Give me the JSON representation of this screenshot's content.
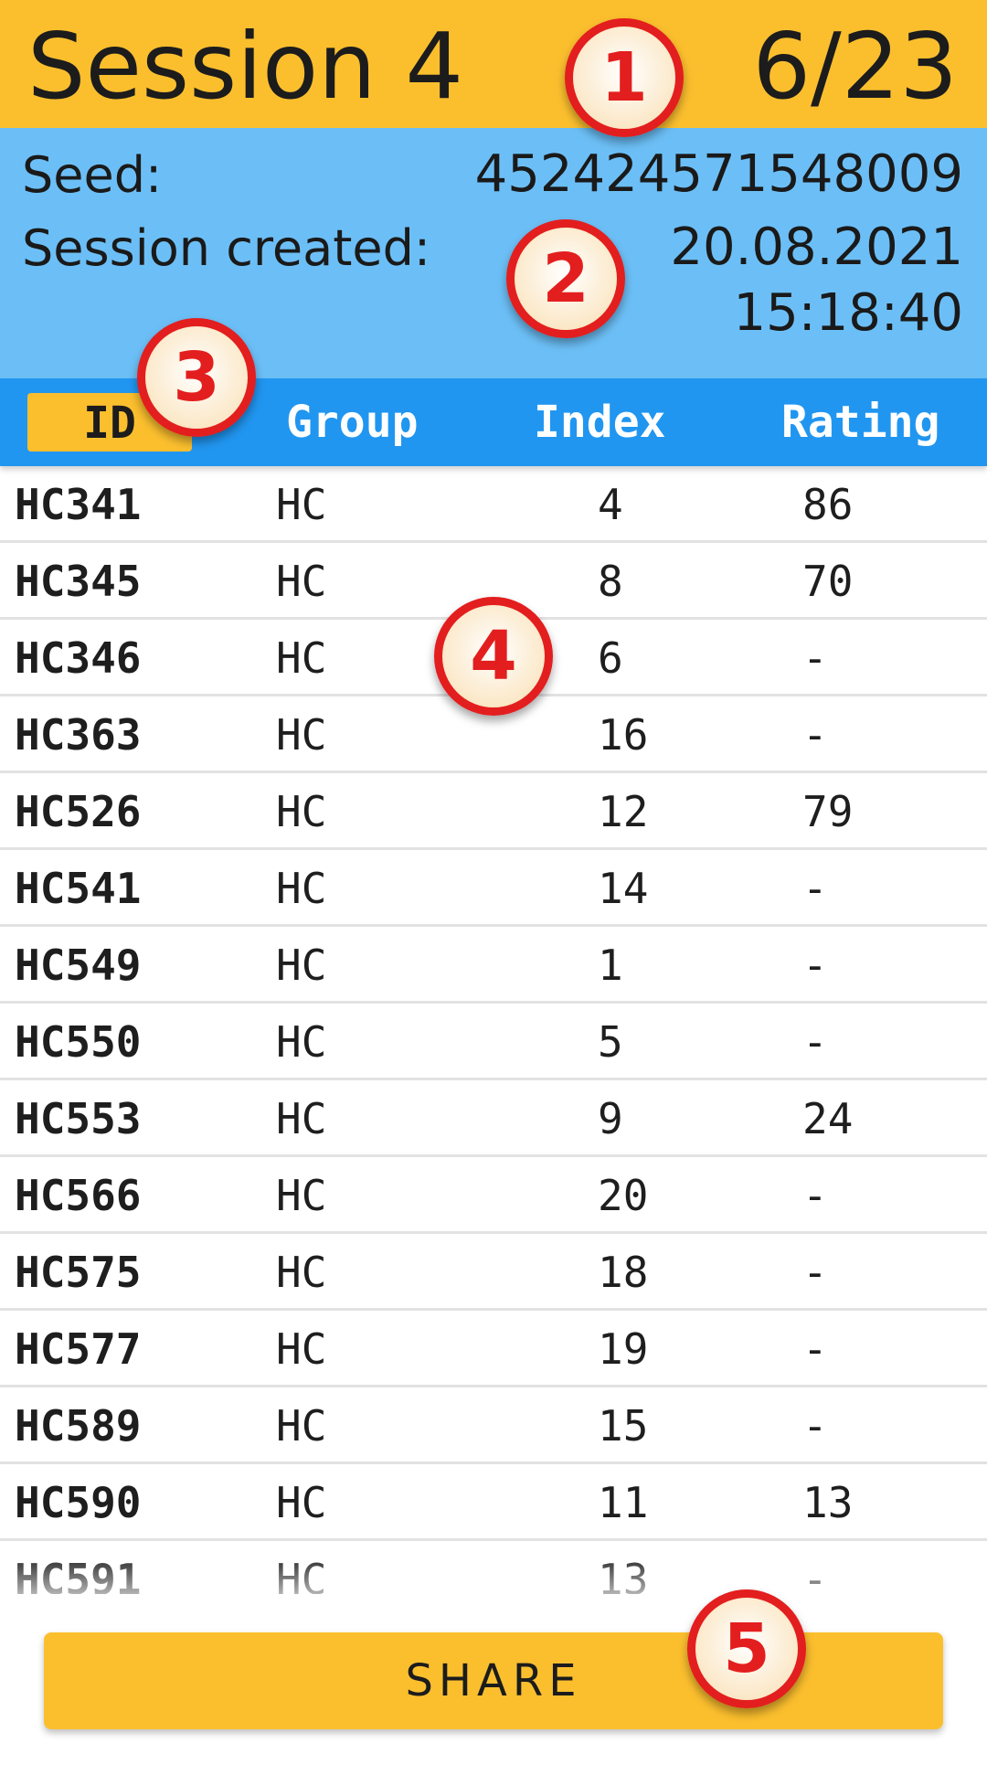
{
  "header": {
    "title": "Session 4",
    "counter": "6/23"
  },
  "info": {
    "seed_label": "Seed:",
    "seed_value": "452424571548009",
    "created_label": "Session created:",
    "created_date": "20.08.2021",
    "created_time": "15:18:40"
  },
  "table": {
    "columns": [
      "ID",
      "Group",
      "Index",
      "Rating"
    ],
    "sorted_column": "ID",
    "rows": [
      [
        "HC341",
        "HC",
        "4",
        "86"
      ],
      [
        "HC345",
        "HC",
        "8",
        "70"
      ],
      [
        "HC346",
        "HC",
        "6",
        "-"
      ],
      [
        "HC363",
        "HC",
        "16",
        "-"
      ],
      [
        "HC526",
        "HC",
        "12",
        "79"
      ],
      [
        "HC541",
        "HC",
        "14",
        "-"
      ],
      [
        "HC549",
        "HC",
        "1",
        "-"
      ],
      [
        "HC550",
        "HC",
        "5",
        "-"
      ],
      [
        "HC553",
        "HC",
        "9",
        "24"
      ],
      [
        "HC566",
        "HC",
        "20",
        "-"
      ],
      [
        "HC575",
        "HC",
        "18",
        "-"
      ],
      [
        "HC577",
        "HC",
        "19",
        "-"
      ],
      [
        "HC589",
        "HC",
        "15",
        "-"
      ],
      [
        "HC590",
        "HC",
        "11",
        "13"
      ],
      [
        "HC591",
        "HC",
        "13",
        "-"
      ]
    ]
  },
  "share_label": "SHARE",
  "annotations": [
    "1",
    "2",
    "3",
    "4",
    "5"
  ],
  "colors": {
    "header_bg": "#fbbf2e",
    "info_bg": "#6cbff6",
    "table_header_bg": "#2196f0",
    "accent": "#fbbf2e",
    "annotation_red": "#e31e1e"
  }
}
